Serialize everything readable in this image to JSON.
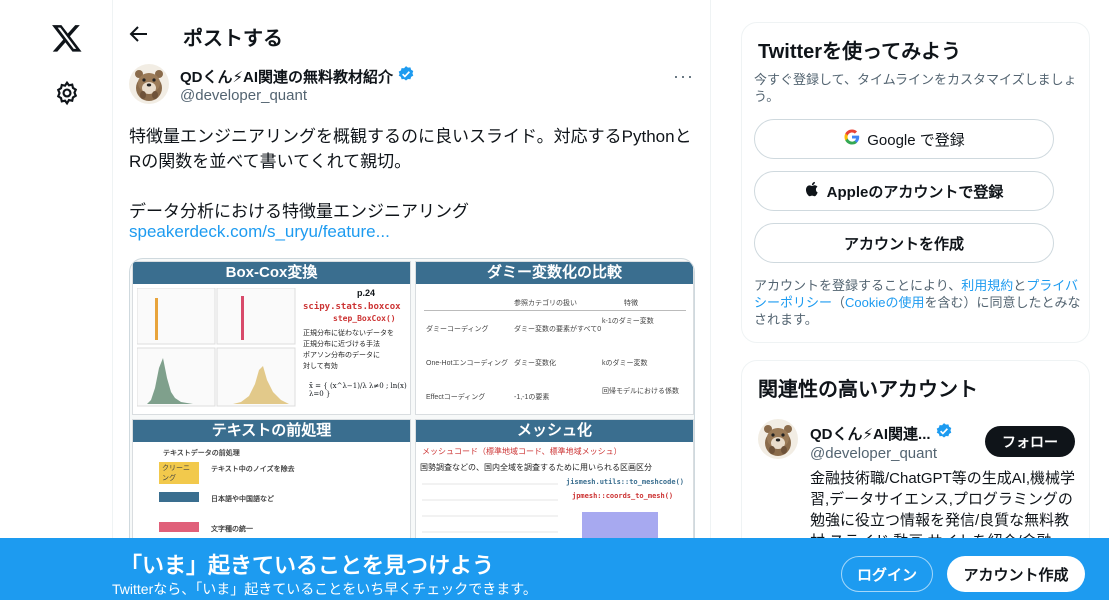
{
  "header": {
    "title": "ポストする"
  },
  "post": {
    "author_name": "QDくん⚡AI関連の無料教材紹介",
    "author_handle": "@developer_quant",
    "text_line1": "特徴量エンジニアリングを概観するのに良いスライド。対応するPythonと",
    "text_line2": "Rの関数を並べて書いてくれて親切。",
    "text_line3": "データ分析における特徴量エンジニアリング",
    "link": "speakerdeck.com/s_uryu/feature...",
    "more_label": "···"
  },
  "media": {
    "slide1": {
      "title": "Box-Cox変換",
      "page": "p.24",
      "func_py": "scipy.stats.boxcox",
      "func_r": "step_BoxCox()",
      "notes": [
        "正規分布に従わないデータを",
        "正規分布に近づける手法",
        "ポアソン分布のデータに",
        "対して有効"
      ],
      "formula": "x̃ = { (x^λ−1)/λ  λ≠0 ; ln(x)  λ=0 }"
    },
    "slide2": {
      "title": "ダミー変数化の比較",
      "headers": [
        "参照カテゴリの扱い",
        "特徴"
      ],
      "rows": [
        [
          "ダミーコーディング",
          "ダミー変数の要素がすべて0",
          "k-1のダミー変数"
        ],
        [
          "One-Hotエンコーディング",
          "ダミー変数化",
          "kのダミー変数"
        ],
        [
          "Effectコーディング",
          "-1,-1の要素",
          "回帰モデルにおける係数"
        ]
      ]
    },
    "slide3": {
      "title": "テキストの前処理",
      "items": [
        "テキストデータの前処理",
        "クリーニング",
        "テキスト中のノイズを除去",
        "日本語や中国語など",
        "文字種の統一"
      ]
    },
    "slide4": {
      "title": "メッシュ化",
      "subtitle": "メッシュコード（標準地域コード、標準地域メッシュ）",
      "desc": "国勢調査などの、国内全域を調査するために用いられる区画区分",
      "func_py": "jismesh.utils::to_meshcode()",
      "func_r": "jpmesh::coords_to_mesh()"
    }
  },
  "signup_panel": {
    "title": "Twitterを使ってみよう",
    "subtitle": "今すぐ登録して、タイムラインをカスタマイズしましょう。",
    "google_label": "Google で登録",
    "apple_label": "Appleのアカウントで登録",
    "create_label": "アカウントを作成",
    "legal_1": "アカウントを登録することにより、",
    "legal_terms": "利用規約",
    "legal_2": "と",
    "legal_privacy": "プライバシーポリシー",
    "legal_3": "（",
    "legal_cookie": "Cookieの使用",
    "legal_4": "を含む）に同意したとみなされます。"
  },
  "related": {
    "title": "関連性の高いアカウント",
    "name": "QDくん⚡AI関連...",
    "handle": "@developer_quant",
    "follow_label": "フォロー",
    "bio": "金融技術職/ChatGPT等の生成AI,機械学習,データサイエンス,プログラミングの勉強に役立つ情報を発信/良質な無料教材,スライド,動画,サイトを紹介/金融"
  },
  "banner": {
    "title": "「いま」起きていることを見つけよう",
    "subtitle": "Twitterなら、「いま」起きていることをいち早くチェックできます。",
    "login_label": "ログイン",
    "signup_label": "アカウント作成"
  },
  "colors": {
    "accent": "#1d9bf0",
    "slide_header": "#3a6e8f",
    "text": "#0f1419",
    "secondary": "#536471"
  },
  "icons": [
    "x-logo-icon",
    "gear-icon",
    "back-arrow-icon",
    "verified-badge-icon",
    "google-icon",
    "apple-icon",
    "more-icon"
  ]
}
